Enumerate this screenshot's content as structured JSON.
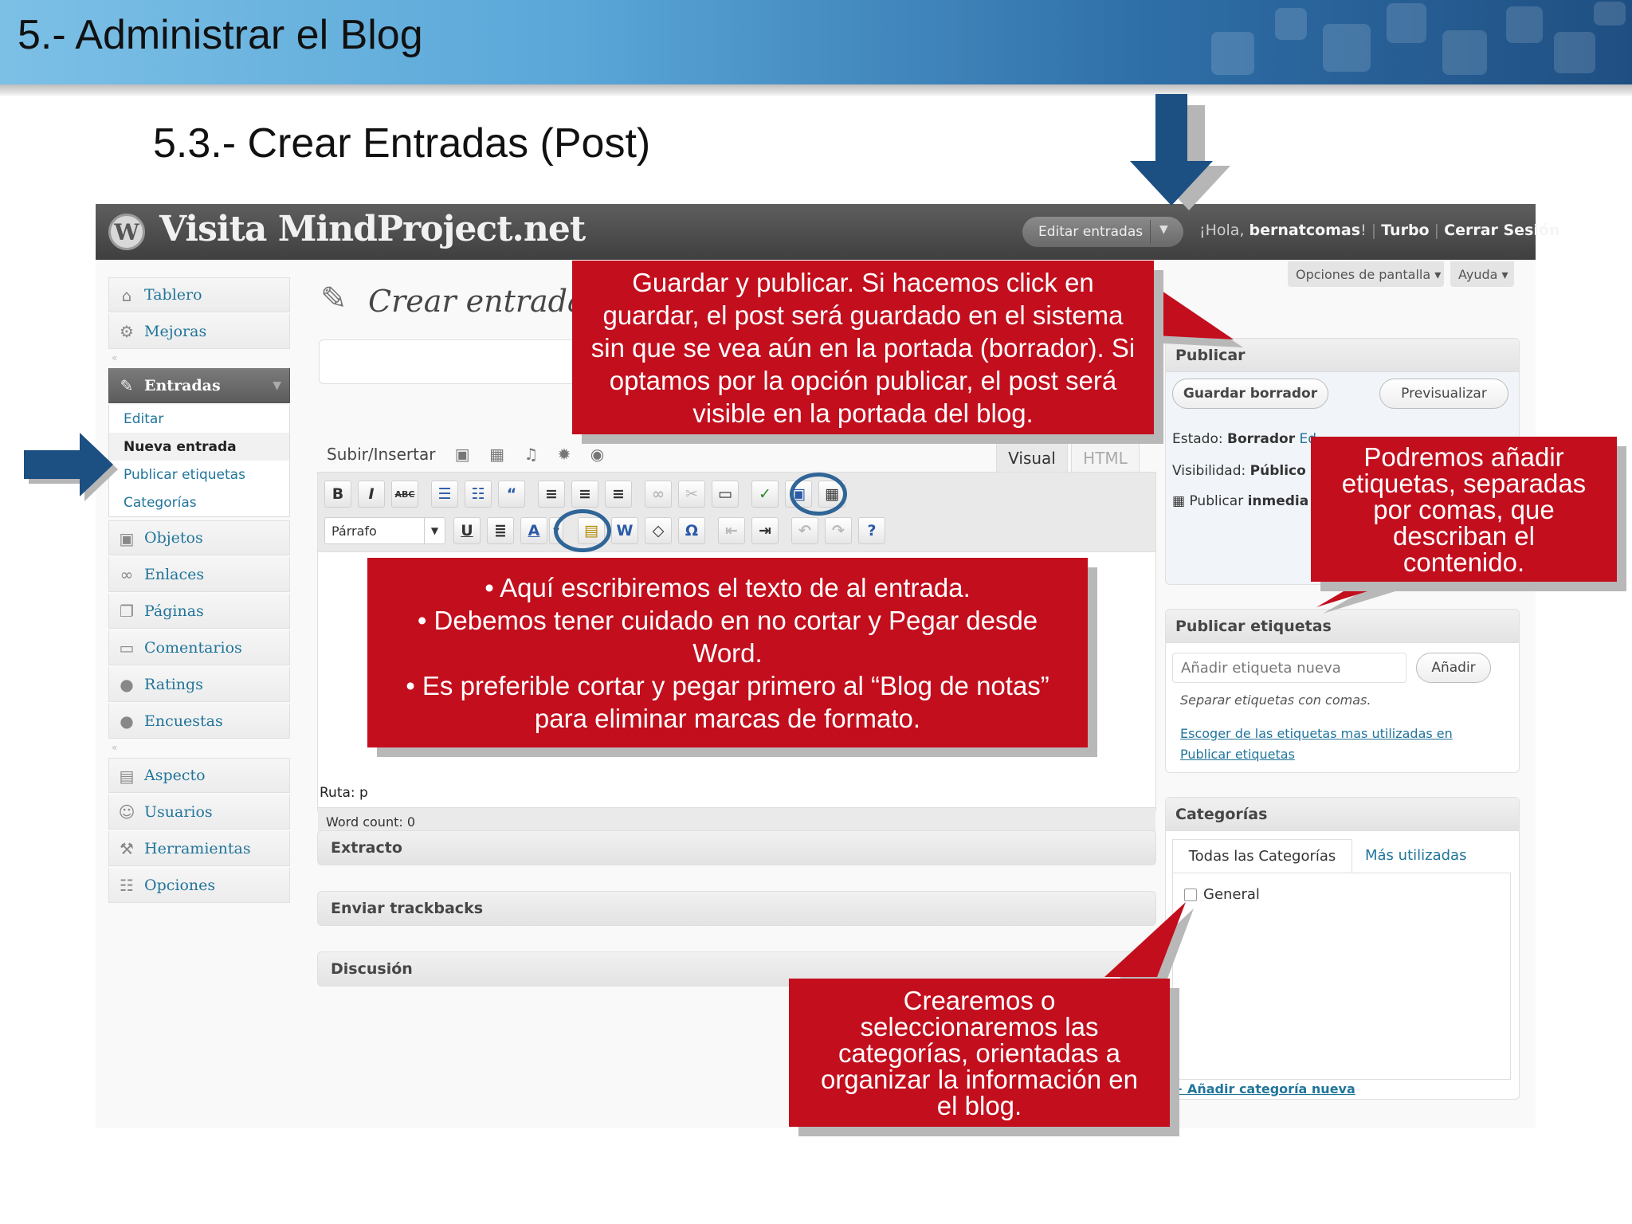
{
  "slide": {
    "title": "5.- Administrar el Blog",
    "subtitle": "5.3.- Crear Entradas (Post)"
  },
  "wp": {
    "site_title": "Visita MindProject.net",
    "logo_letter": "W",
    "fav_actions": "Editar entradas",
    "user_greeting": "¡Hola, ",
    "user_name": "bernatcomas",
    "user_greeting_end": "!",
    "turbo": "Turbo",
    "logout": "Cerrar Sesión",
    "screen_options": "Opciones de pantalla ▾",
    "help": "Ayuda ▾"
  },
  "menu": {
    "tablero": "Tablero",
    "mejoras": "Mejoras",
    "entradas": "Entradas",
    "sub_editar": "Editar",
    "sub_nueva": "Nueva entrada",
    "sub_etiquetas": "Publicar etiquetas",
    "sub_categorias": "Categorías",
    "objetos": "Objetos",
    "enlaces": "Enlaces",
    "paginas": "Páginas",
    "comentarios": "Comentarios",
    "ratings": "Ratings",
    "encuestas": "Encuestas",
    "aspecto": "Aspecto",
    "usuarios": "Usuarios",
    "herramientas": "Herramientas",
    "opciones": "Opciones"
  },
  "editor": {
    "page_title": "Crear entrada",
    "upload_label": "Subir/Insertar",
    "tab_visual": "Visual",
    "tab_html": "HTML",
    "paragraph": "Párrafo",
    "ruta": "Ruta: p",
    "word_count": "Word count: 0"
  },
  "postboxes": {
    "extracto": "Extracto",
    "trackbacks": "Enviar trackbacks",
    "discusion": "Discusión"
  },
  "publish": {
    "header": "Publicar",
    "save_draft": "Guardar borrador",
    "preview": "Previsualizar",
    "status_label": "Estado: ",
    "status_value": "Borrador",
    "status_edit": "Ed",
    "visibility_label": "Visibilidad: ",
    "visibility_value": "Público",
    "publish_label": "Publicar ",
    "publish_value": "inmedia"
  },
  "tags": {
    "header": "Publicar etiquetas",
    "placeholder": "Añadir etiqueta nueva",
    "add_button": "Añadir",
    "hint": "Separar etiquetas con comas.",
    "link_line1": "Escoger de las etiquetas mas utilizadas en",
    "link_line2": "Publicar etiquetas"
  },
  "categories": {
    "header": "Categorías",
    "tab_all": "Todas las Categorías",
    "tab_popular": "Más utilizadas",
    "item_general": "General",
    "add_link": "+ Añadir categoría nueva"
  },
  "callouts": {
    "publicar": "Guardar y publicar. Si hacemos click en guardar, el post será guardado en el sistema sin que se vea aún en la portada (borrador). Si optamos por la opción publicar, el post será visible en la portada del blog.",
    "editor_line1": "• Aquí escribiremos el texto de al entrada.",
    "editor_line2": "• Debemos tener cuidado en no cortar y Pegar desde Word.",
    "editor_line3": "• Es preferible cortar y pegar primero al “Blog de notas” para eliminar marcas de formato.",
    "etiquetas": "Podremos añadir etiquetas, separadas por comas, que describan el contenido.",
    "categorias": "Crearemos o seleccionaremos  las categorías, orientadas a organizar la información en el blog."
  },
  "colors": {
    "callout_red": "#c30e1d",
    "arrow_blue": "#1c4f82",
    "wp_link": "#21759b",
    "wp_header": "#464646"
  }
}
